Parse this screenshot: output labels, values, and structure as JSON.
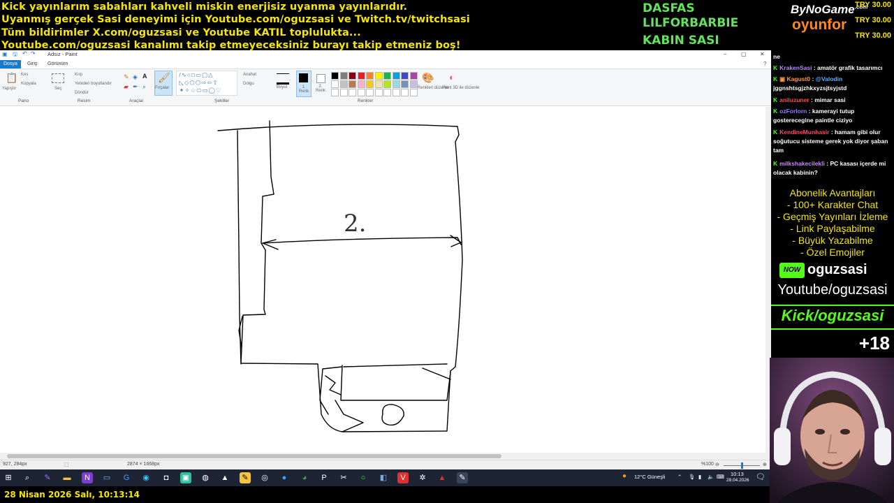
{
  "banner": {
    "lines": [
      "Kick yayınlarım sabahları kahveli miskin enerjisiz uyanma yayınlarıdır.",
      "Uyanmış gerçek Sasi deneyimi için Youtube.com/oguzsasi ve Twitch.tv/twitchsasi",
      "Tüm bildirimler X.com/oguzsasi ve Youtube KATIL toplulukta...",
      "Youtube.com/oguzsasi kanalımı takip etmeyeceksiniz burayı takip etmeniz boş!"
    ]
  },
  "alerts": [
    "DASFAS",
    "LILFORBARBIE",
    "KABIN SASI"
  ],
  "brand": {
    "line1": "ByNoGame",
    "line1_sup": ".com",
    "line2": "oyunfor",
    "prices": [
      "TRY 30.00",
      "TRY 30.00",
      "TRY 30.00"
    ]
  },
  "paint": {
    "title": "Adsız - Paint",
    "window_controls": [
      "–",
      "▢",
      "✕"
    ],
    "menu": {
      "file": "Dosya",
      "home": "Giriş",
      "view": "Görünüm"
    },
    "ribbon": {
      "paste": "Yapıştır",
      "cut": "Kes",
      "copy": "Kopyala",
      "select": "Seç",
      "crop": "Kırp",
      "resize": "Yeniden boyutlandır",
      "rotate": "Döndür",
      "brushes": "Fırçalar",
      "outline": "Anahat",
      "fill": "Dolgu",
      "size": "Boyut",
      "color1": "1. Renk",
      "color2": "2. Renk",
      "edit_colors": "Renkleri düzenle",
      "paint3d": "Paint 3D ile düzenle",
      "groups": {
        "clipboard": "Pano",
        "image": "Resim",
        "tools": "Araçlar",
        "shapes": "Şekiller",
        "colors": "Renkler"
      },
      "palette": [
        "#000000",
        "#7f7f7f",
        "#880015",
        "#ed1c24",
        "#ff7f27",
        "#fff200",
        "#22b14c",
        "#00a2e8",
        "#3f48cc",
        "#a349a4",
        "#ffffff",
        "#c3c3c3",
        "#b97a57",
        "#ffaec9",
        "#ffc90e",
        "#efe4b0",
        "#b5e61d",
        "#99d9ea",
        "#7092be",
        "#c8bfe7"
      ]
    },
    "canvas_text": "2.",
    "status": {
      "cursor": "927, 284px",
      "size": "2874 × 1668px",
      "zoom": "%100"
    }
  },
  "taskbar": {
    "weather": "12°C  Güneşli",
    "time": "10:13",
    "date": "28.04.2026"
  },
  "datebar": "28 Nisan 2026 Salı, 10:13:14",
  "chat": {
    "messages": [
      {
        "user": "",
        "text": "ne"
      },
      {
        "user": "KrakenSasi",
        "text": ": amatör grafik tasarımcı"
      },
      {
        "user": "Kagust0",
        "mention": "@Valodin",
        "text": "jggnshtsgjzhkxyzsjtsyjstd"
      },
      {
        "user": "aniluzuner",
        "text": ": mimar sasi"
      },
      {
        "user": "ozForlorn",
        "text": ": kamerayi tutup gosterecegine paintle ciziyo"
      },
      {
        "user": "KendineMunhasir",
        "text": ": hamam gibi olur soğutucu sisteme gerek yok diyor şaban tam"
      },
      {
        "user": "milkshakecilekli",
        "text": ": PC kasası içerde mi olacak kabinin?"
      }
    ],
    "perks_title": "Abonelik Avantajları",
    "perks": [
      "- 100+ Karakter Chat",
      "- Geçmiş Yayınları İzleme",
      "- Link Paylaşabilme",
      "- Büyük Yazabilme",
      "- Özel Emojiler"
    ],
    "kick_name": "oguzsasi",
    "youtube": "Youtube/oguzsasi",
    "kick_link": "Kick/oguzsasi",
    "age": "+18"
  },
  "colors": {
    "banner_yellow": "#f5e600",
    "alert_green": "#62e35a",
    "kick_green": "#53fc18",
    "paint_blue": "#1979ca"
  }
}
